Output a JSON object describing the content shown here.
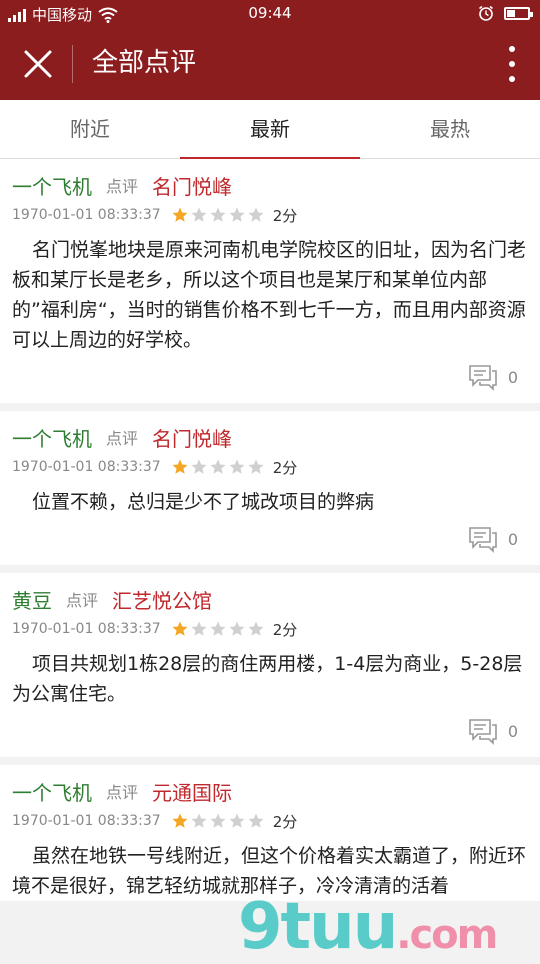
{
  "status": {
    "carrier": "中国移动",
    "time": "09:44",
    "icons": [
      "signal-icon",
      "wifi-icon",
      "alarm-icon",
      "battery-icon"
    ]
  },
  "appbar": {
    "title": "全部点评",
    "close_icon": "close-icon",
    "more_icon": "more-vertical-icon",
    "color": "#8c1d1f"
  },
  "tabs": [
    {
      "label": "附近",
      "active": false
    },
    {
      "label": "最新",
      "active": true
    },
    {
      "label": "最热",
      "active": false
    }
  ],
  "reviews": [
    {
      "user": "一个飞机",
      "verb": "点评",
      "project": "名门悦峰",
      "time": "1970-01-01 08:33:37",
      "rating": 1,
      "max_rating": 5,
      "score": "2分",
      "text": "名门悦峯地块是原来河南机电学院校区的旧址，因为名门老板和某厅长是老乡，所以这个项目也是某厅和某单位内部的”福利房“，当时的销售价格不到七千一方，而且用内部资源可以上周边的好学校。",
      "comments": "0"
    },
    {
      "user": "一个飞机",
      "verb": "点评",
      "project": "名门悦峰",
      "time": "1970-01-01 08:33:37",
      "rating": 1,
      "max_rating": 5,
      "score": "2分",
      "text": "位置不赖，总归是少不了城改项目的弊病",
      "comments": "0"
    },
    {
      "user": "黄豆",
      "verb": "点评",
      "project": "汇艺悦公馆",
      "time": "1970-01-01 08:33:37",
      "rating": 1,
      "max_rating": 5,
      "score": "2分",
      "text": "项目共规划1栋28层的商住两用楼，1-4层为商业，5-28层为公寓住宅。",
      "comments": "0"
    },
    {
      "user": "一个飞机",
      "verb": "点评",
      "project": "元通国际",
      "time": "1970-01-01 08:33:37",
      "rating": 1,
      "max_rating": 5,
      "score": "2分",
      "text": "虽然在地铁一号线附近，但这个价格着实太霸道了，附近环境不是很好，锦艺轻纺城就那样子，冷冷清清的活着",
      "comments": ""
    }
  ],
  "watermark": {
    "main": "9tuu",
    "suffix": ".com"
  }
}
